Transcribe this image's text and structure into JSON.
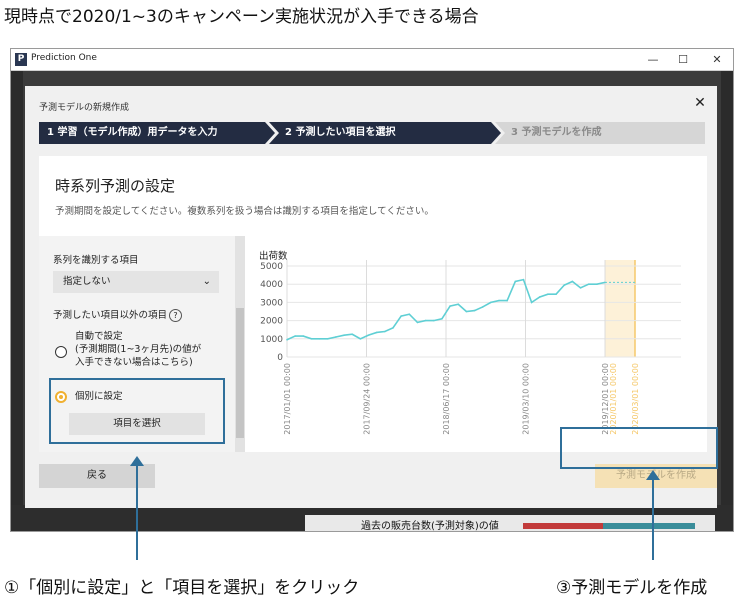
{
  "caption_top": "現時点で2020/1~3のキャンペーン実施状況が入手できる場合",
  "window": {
    "logo": "P",
    "title": "Prediction One",
    "minimize": "—",
    "maximize": "☐",
    "close": "✕"
  },
  "background": {
    "bottom_text": "過去の販売台数(予測対象)の値"
  },
  "dialog": {
    "title": "予測モデルの新規作成",
    "close": "✕",
    "steps": [
      {
        "label": "1 学習（モデル作成）用データを入力"
      },
      {
        "label": "2 予測したい項目を選択"
      },
      {
        "label": "3 予測モデルを作成"
      }
    ],
    "section_title": "時系列予測の設定",
    "section_desc": "予測期間を設定してください。複数系列を扱う場合は識別する項目を指定してください。",
    "left": {
      "series_label": "系列を識別する項目",
      "series_select": "指定しない",
      "chev": "⌄",
      "other_items_label": "予測したい項目以外の項目",
      "help": "?",
      "auto_option": "自動で設定\n(予測期間(1~3ヶ月先)の値が\n入手できない場合はこちら)",
      "individual_option": "個別に設定",
      "select_items_button": "項目を選択"
    },
    "back_button": "戻る",
    "create_button": "予測モデルを作成"
  },
  "chart_data": {
    "type": "line",
    "title": "出荷数",
    "ylim": [
      0,
      5000
    ],
    "yticks": [
      0,
      1000,
      2000,
      3000,
      4000,
      5000
    ],
    "xticks": [
      "2017/01/01 00:00",
      "2017/09/24 00:00",
      "2018/06/17 00:00",
      "2019/03/10 00:00",
      "2019/12/01 00:00",
      "2020/01/01 00:00",
      "2020/03/01 00:00"
    ],
    "grid": true,
    "series": [
      {
        "values": [
          950,
          1150,
          1150,
          1000,
          1000,
          1000,
          1100,
          1200,
          1250,
          1000,
          1200,
          1350,
          1400,
          1600,
          2250,
          2350,
          1900,
          2000,
          2000,
          2100,
          2800,
          2900,
          2500,
          2550,
          2750,
          3000,
          3100,
          3100,
          4150,
          4250,
          3000,
          3300,
          3450,
          3450,
          3950,
          4150,
          3800,
          4000,
          4000,
          4100
        ],
        "color": "#5fcfd4"
      }
    ],
    "forecast_value": 4100,
    "forecast_color": "#f5c86a"
  },
  "captions_bottom": {
    "left": "①「個別に設定」と「項目を選択」をクリック",
    "right": "③予測モデルを作成"
  }
}
